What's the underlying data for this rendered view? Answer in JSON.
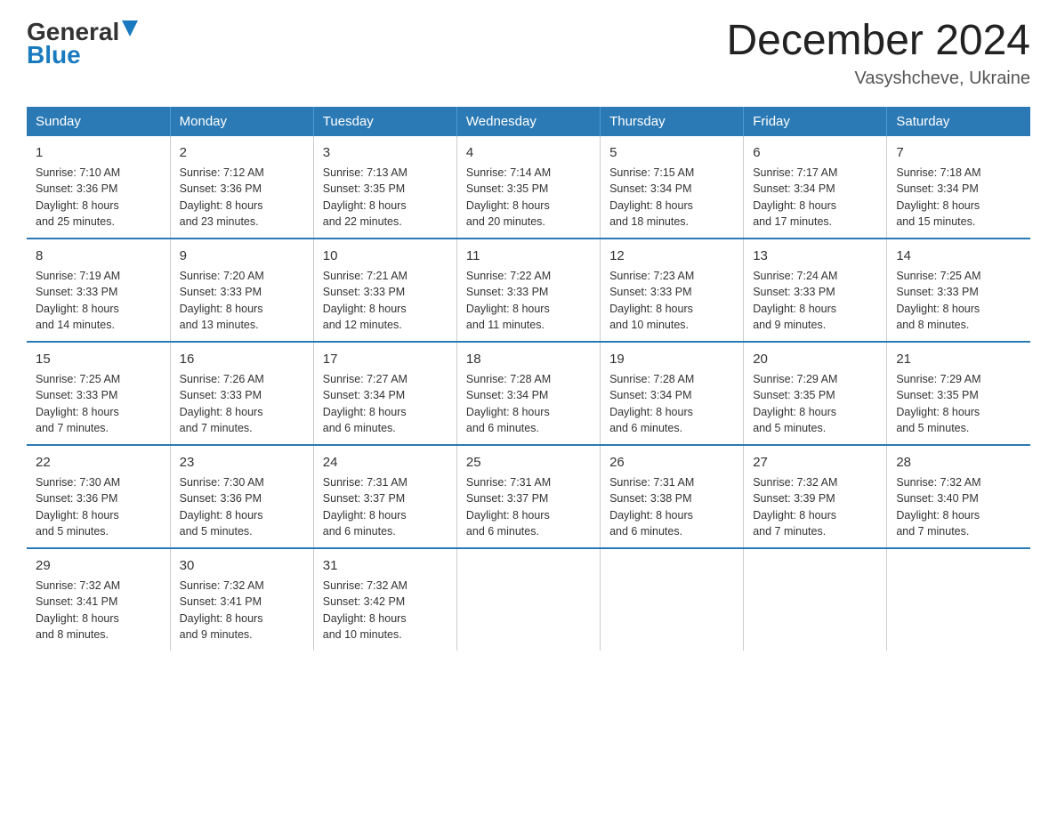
{
  "header": {
    "logo_general": "General",
    "logo_blue": "Blue",
    "title": "December 2024",
    "subtitle": "Vasyshcheve, Ukraine"
  },
  "days_of_week": [
    "Sunday",
    "Monday",
    "Tuesday",
    "Wednesday",
    "Thursday",
    "Friday",
    "Saturday"
  ],
  "weeks": [
    [
      {
        "day": "1",
        "sunrise": "7:10 AM",
        "sunset": "3:36 PM",
        "daylight": "8 hours and 25 minutes."
      },
      {
        "day": "2",
        "sunrise": "7:12 AM",
        "sunset": "3:36 PM",
        "daylight": "8 hours and 23 minutes."
      },
      {
        "day": "3",
        "sunrise": "7:13 AM",
        "sunset": "3:35 PM",
        "daylight": "8 hours and 22 minutes."
      },
      {
        "day": "4",
        "sunrise": "7:14 AM",
        "sunset": "3:35 PM",
        "daylight": "8 hours and 20 minutes."
      },
      {
        "day": "5",
        "sunrise": "7:15 AM",
        "sunset": "3:34 PM",
        "daylight": "8 hours and 18 minutes."
      },
      {
        "day": "6",
        "sunrise": "7:17 AM",
        "sunset": "3:34 PM",
        "daylight": "8 hours and 17 minutes."
      },
      {
        "day": "7",
        "sunrise": "7:18 AM",
        "sunset": "3:34 PM",
        "daylight": "8 hours and 15 minutes."
      }
    ],
    [
      {
        "day": "8",
        "sunrise": "7:19 AM",
        "sunset": "3:33 PM",
        "daylight": "8 hours and 14 minutes."
      },
      {
        "day": "9",
        "sunrise": "7:20 AM",
        "sunset": "3:33 PM",
        "daylight": "8 hours and 13 minutes."
      },
      {
        "day": "10",
        "sunrise": "7:21 AM",
        "sunset": "3:33 PM",
        "daylight": "8 hours and 12 minutes."
      },
      {
        "day": "11",
        "sunrise": "7:22 AM",
        "sunset": "3:33 PM",
        "daylight": "8 hours and 11 minutes."
      },
      {
        "day": "12",
        "sunrise": "7:23 AM",
        "sunset": "3:33 PM",
        "daylight": "8 hours and 10 minutes."
      },
      {
        "day": "13",
        "sunrise": "7:24 AM",
        "sunset": "3:33 PM",
        "daylight": "8 hours and 9 minutes."
      },
      {
        "day": "14",
        "sunrise": "7:25 AM",
        "sunset": "3:33 PM",
        "daylight": "8 hours and 8 minutes."
      }
    ],
    [
      {
        "day": "15",
        "sunrise": "7:25 AM",
        "sunset": "3:33 PM",
        "daylight": "8 hours and 7 minutes."
      },
      {
        "day": "16",
        "sunrise": "7:26 AM",
        "sunset": "3:33 PM",
        "daylight": "8 hours and 7 minutes."
      },
      {
        "day": "17",
        "sunrise": "7:27 AM",
        "sunset": "3:34 PM",
        "daylight": "8 hours and 6 minutes."
      },
      {
        "day": "18",
        "sunrise": "7:28 AM",
        "sunset": "3:34 PM",
        "daylight": "8 hours and 6 minutes."
      },
      {
        "day": "19",
        "sunrise": "7:28 AM",
        "sunset": "3:34 PM",
        "daylight": "8 hours and 6 minutes."
      },
      {
        "day": "20",
        "sunrise": "7:29 AM",
        "sunset": "3:35 PM",
        "daylight": "8 hours and 5 minutes."
      },
      {
        "day": "21",
        "sunrise": "7:29 AM",
        "sunset": "3:35 PM",
        "daylight": "8 hours and 5 minutes."
      }
    ],
    [
      {
        "day": "22",
        "sunrise": "7:30 AM",
        "sunset": "3:36 PM",
        "daylight": "8 hours and 5 minutes."
      },
      {
        "day": "23",
        "sunrise": "7:30 AM",
        "sunset": "3:36 PM",
        "daylight": "8 hours and 5 minutes."
      },
      {
        "day": "24",
        "sunrise": "7:31 AM",
        "sunset": "3:37 PM",
        "daylight": "8 hours and 6 minutes."
      },
      {
        "day": "25",
        "sunrise": "7:31 AM",
        "sunset": "3:37 PM",
        "daylight": "8 hours and 6 minutes."
      },
      {
        "day": "26",
        "sunrise": "7:31 AM",
        "sunset": "3:38 PM",
        "daylight": "8 hours and 6 minutes."
      },
      {
        "day": "27",
        "sunrise": "7:32 AM",
        "sunset": "3:39 PM",
        "daylight": "8 hours and 7 minutes."
      },
      {
        "day": "28",
        "sunrise": "7:32 AM",
        "sunset": "3:40 PM",
        "daylight": "8 hours and 7 minutes."
      }
    ],
    [
      {
        "day": "29",
        "sunrise": "7:32 AM",
        "sunset": "3:41 PM",
        "daylight": "8 hours and 8 minutes."
      },
      {
        "day": "30",
        "sunrise": "7:32 AM",
        "sunset": "3:41 PM",
        "daylight": "8 hours and 9 minutes."
      },
      {
        "day": "31",
        "sunrise": "7:32 AM",
        "sunset": "3:42 PM",
        "daylight": "8 hours and 10 minutes."
      },
      null,
      null,
      null,
      null
    ]
  ],
  "labels": {
    "sunrise": "Sunrise:",
    "sunset": "Sunset:",
    "daylight": "Daylight:"
  }
}
